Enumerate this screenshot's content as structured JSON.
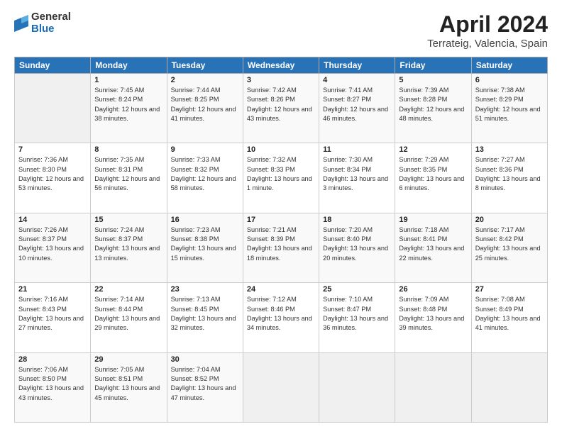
{
  "logo": {
    "general": "General",
    "blue": "Blue"
  },
  "header": {
    "title": "April 2024",
    "subtitle": "Terrateig, Valencia, Spain"
  },
  "weekdays": [
    "Sunday",
    "Monday",
    "Tuesday",
    "Wednesday",
    "Thursday",
    "Friday",
    "Saturday"
  ],
  "weeks": [
    [
      {
        "day": "",
        "sunrise": "",
        "sunset": "",
        "daylight": ""
      },
      {
        "day": "1",
        "sunrise": "Sunrise: 7:45 AM",
        "sunset": "Sunset: 8:24 PM",
        "daylight": "Daylight: 12 hours and 38 minutes."
      },
      {
        "day": "2",
        "sunrise": "Sunrise: 7:44 AM",
        "sunset": "Sunset: 8:25 PM",
        "daylight": "Daylight: 12 hours and 41 minutes."
      },
      {
        "day": "3",
        "sunrise": "Sunrise: 7:42 AM",
        "sunset": "Sunset: 8:26 PM",
        "daylight": "Daylight: 12 hours and 43 minutes."
      },
      {
        "day": "4",
        "sunrise": "Sunrise: 7:41 AM",
        "sunset": "Sunset: 8:27 PM",
        "daylight": "Daylight: 12 hours and 46 minutes."
      },
      {
        "day": "5",
        "sunrise": "Sunrise: 7:39 AM",
        "sunset": "Sunset: 8:28 PM",
        "daylight": "Daylight: 12 hours and 48 minutes."
      },
      {
        "day": "6",
        "sunrise": "Sunrise: 7:38 AM",
        "sunset": "Sunset: 8:29 PM",
        "daylight": "Daylight: 12 hours and 51 minutes."
      }
    ],
    [
      {
        "day": "7",
        "sunrise": "Sunrise: 7:36 AM",
        "sunset": "Sunset: 8:30 PM",
        "daylight": "Daylight: 12 hours and 53 minutes."
      },
      {
        "day": "8",
        "sunrise": "Sunrise: 7:35 AM",
        "sunset": "Sunset: 8:31 PM",
        "daylight": "Daylight: 12 hours and 56 minutes."
      },
      {
        "day": "9",
        "sunrise": "Sunrise: 7:33 AM",
        "sunset": "Sunset: 8:32 PM",
        "daylight": "Daylight: 12 hours and 58 minutes."
      },
      {
        "day": "10",
        "sunrise": "Sunrise: 7:32 AM",
        "sunset": "Sunset: 8:33 PM",
        "daylight": "Daylight: 13 hours and 1 minute."
      },
      {
        "day": "11",
        "sunrise": "Sunrise: 7:30 AM",
        "sunset": "Sunset: 8:34 PM",
        "daylight": "Daylight: 13 hours and 3 minutes."
      },
      {
        "day": "12",
        "sunrise": "Sunrise: 7:29 AM",
        "sunset": "Sunset: 8:35 PM",
        "daylight": "Daylight: 13 hours and 6 minutes."
      },
      {
        "day": "13",
        "sunrise": "Sunrise: 7:27 AM",
        "sunset": "Sunset: 8:36 PM",
        "daylight": "Daylight: 13 hours and 8 minutes."
      }
    ],
    [
      {
        "day": "14",
        "sunrise": "Sunrise: 7:26 AM",
        "sunset": "Sunset: 8:37 PM",
        "daylight": "Daylight: 13 hours and 10 minutes."
      },
      {
        "day": "15",
        "sunrise": "Sunrise: 7:24 AM",
        "sunset": "Sunset: 8:37 PM",
        "daylight": "Daylight: 13 hours and 13 minutes."
      },
      {
        "day": "16",
        "sunrise": "Sunrise: 7:23 AM",
        "sunset": "Sunset: 8:38 PM",
        "daylight": "Daylight: 13 hours and 15 minutes."
      },
      {
        "day": "17",
        "sunrise": "Sunrise: 7:21 AM",
        "sunset": "Sunset: 8:39 PM",
        "daylight": "Daylight: 13 hours and 18 minutes."
      },
      {
        "day": "18",
        "sunrise": "Sunrise: 7:20 AM",
        "sunset": "Sunset: 8:40 PM",
        "daylight": "Daylight: 13 hours and 20 minutes."
      },
      {
        "day": "19",
        "sunrise": "Sunrise: 7:18 AM",
        "sunset": "Sunset: 8:41 PM",
        "daylight": "Daylight: 13 hours and 22 minutes."
      },
      {
        "day": "20",
        "sunrise": "Sunrise: 7:17 AM",
        "sunset": "Sunset: 8:42 PM",
        "daylight": "Daylight: 13 hours and 25 minutes."
      }
    ],
    [
      {
        "day": "21",
        "sunrise": "Sunrise: 7:16 AM",
        "sunset": "Sunset: 8:43 PM",
        "daylight": "Daylight: 13 hours and 27 minutes."
      },
      {
        "day": "22",
        "sunrise": "Sunrise: 7:14 AM",
        "sunset": "Sunset: 8:44 PM",
        "daylight": "Daylight: 13 hours and 29 minutes."
      },
      {
        "day": "23",
        "sunrise": "Sunrise: 7:13 AM",
        "sunset": "Sunset: 8:45 PM",
        "daylight": "Daylight: 13 hours and 32 minutes."
      },
      {
        "day": "24",
        "sunrise": "Sunrise: 7:12 AM",
        "sunset": "Sunset: 8:46 PM",
        "daylight": "Daylight: 13 hours and 34 minutes."
      },
      {
        "day": "25",
        "sunrise": "Sunrise: 7:10 AM",
        "sunset": "Sunset: 8:47 PM",
        "daylight": "Daylight: 13 hours and 36 minutes."
      },
      {
        "day": "26",
        "sunrise": "Sunrise: 7:09 AM",
        "sunset": "Sunset: 8:48 PM",
        "daylight": "Daylight: 13 hours and 39 minutes."
      },
      {
        "day": "27",
        "sunrise": "Sunrise: 7:08 AM",
        "sunset": "Sunset: 8:49 PM",
        "daylight": "Daylight: 13 hours and 41 minutes."
      }
    ],
    [
      {
        "day": "28",
        "sunrise": "Sunrise: 7:06 AM",
        "sunset": "Sunset: 8:50 PM",
        "daylight": "Daylight: 13 hours and 43 minutes."
      },
      {
        "day": "29",
        "sunrise": "Sunrise: 7:05 AM",
        "sunset": "Sunset: 8:51 PM",
        "daylight": "Daylight: 13 hours and 45 minutes."
      },
      {
        "day": "30",
        "sunrise": "Sunrise: 7:04 AM",
        "sunset": "Sunset: 8:52 PM",
        "daylight": "Daylight: 13 hours and 47 minutes."
      },
      {
        "day": "",
        "sunrise": "",
        "sunset": "",
        "daylight": ""
      },
      {
        "day": "",
        "sunrise": "",
        "sunset": "",
        "daylight": ""
      },
      {
        "day": "",
        "sunrise": "",
        "sunset": "",
        "daylight": ""
      },
      {
        "day": "",
        "sunrise": "",
        "sunset": "",
        "daylight": ""
      }
    ]
  ]
}
